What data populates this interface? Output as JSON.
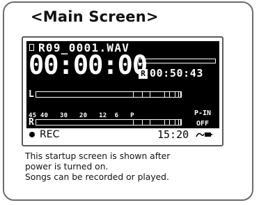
{
  "title": "<Main Screen>",
  "lcd": {
    "filename": "R09_0001.WAV",
    "counter": "00:00:00",
    "remain_icon": "R",
    "remain_time": "00:50:43",
    "channel_left": "L",
    "channel_right": "R",
    "meter_scale": "45 40   30   20   12  6   P",
    "pin_line1": "P-IN",
    "pin_line2": "OFF",
    "status": "REC",
    "clock": "15:20",
    "battery_icon": "battery-icon"
  },
  "description": {
    "line1": "This startup screen is shown after",
    "line2": "power is turned on.",
    "line3": "Songs can be recorded or played."
  }
}
